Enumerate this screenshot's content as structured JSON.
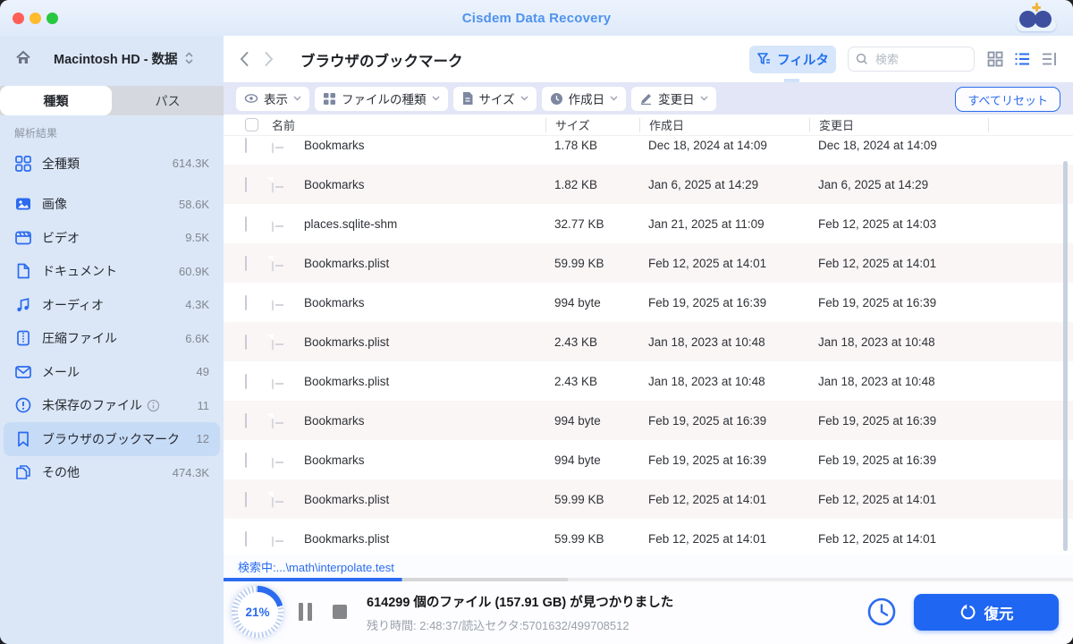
{
  "window": {
    "title": "Cisdem Data Recovery"
  },
  "sidebar": {
    "drive_label": "Macintosh HD - 数据",
    "tabs": [
      {
        "label": "種類"
      },
      {
        "label": "パス"
      }
    ],
    "section_label": "解析結果",
    "items": [
      {
        "label": "全種類",
        "count": "614.3K",
        "icon": "grid-icon"
      },
      {
        "label": "画像",
        "count": "58.6K",
        "icon": "image-icon"
      },
      {
        "label": "ビデオ",
        "count": "9.5K",
        "icon": "video-icon"
      },
      {
        "label": "ドキュメント",
        "count": "60.9K",
        "icon": "document-icon"
      },
      {
        "label": "オーディオ",
        "count": "4.3K",
        "icon": "audio-icon"
      },
      {
        "label": "圧縮ファイル",
        "count": "6.6K",
        "icon": "archive-icon"
      },
      {
        "label": "メール",
        "count": "49",
        "icon": "mail-icon"
      },
      {
        "label": "未保存のファイル",
        "count": "11",
        "icon": "unsaved-icon"
      },
      {
        "label": "ブラウザのブックマーク",
        "count": "12",
        "icon": "bookmark-icon"
      },
      {
        "label": "その他",
        "count": "474.3K",
        "icon": "others-icon"
      }
    ]
  },
  "toolbar": {
    "page_title": "ブラウザのブックマーク",
    "filter_label": "フィルタ",
    "search_placeholder": "検索"
  },
  "filter_bar": {
    "chips": [
      {
        "label": "表示",
        "icon": "eye-icon"
      },
      {
        "label": "ファイルの種類",
        "icon": "grid-icon"
      },
      {
        "label": "サイズ",
        "icon": "file-icon"
      },
      {
        "label": "作成日",
        "icon": "clock-icon"
      },
      {
        "label": "変更日",
        "icon": "pencil-icon"
      }
    ],
    "reset_label": "すべてリセット"
  },
  "table": {
    "columns": {
      "name": "名前",
      "size": "サイズ",
      "created": "作成日",
      "modified": "変更日"
    },
    "rows": [
      {
        "name": "Bookmarks",
        "size": "1.78 KB",
        "created": "Dec 18, 2024 at 14:09",
        "modified": "Dec 18, 2024 at 14:09"
      },
      {
        "name": "Bookmarks",
        "size": "1.82 KB",
        "created": "Jan 6, 2025 at 14:29",
        "modified": "Jan 6, 2025 at 14:29"
      },
      {
        "name": "places.sqlite-shm",
        "size": "32.77 KB",
        "created": "Jan 21, 2025 at 11:09",
        "modified": "Feb 12, 2025 at 14:03"
      },
      {
        "name": "Bookmarks.plist",
        "size": "59.99 KB",
        "created": "Feb 12, 2025 at 14:01",
        "modified": "Feb 12, 2025 at 14:01"
      },
      {
        "name": "Bookmarks",
        "size": "994 byte",
        "created": "Feb 19, 2025 at 16:39",
        "modified": "Feb 19, 2025 at 16:39"
      },
      {
        "name": "Bookmarks.plist",
        "size": "2.43 KB",
        "created": "Jan 18, 2023 at 10:48",
        "modified": "Jan 18, 2023 at 10:48"
      },
      {
        "name": "Bookmarks.plist",
        "size": "2.43 KB",
        "created": "Jan 18, 2023 at 10:48",
        "modified": "Jan 18, 2023 at 10:48"
      },
      {
        "name": "Bookmarks",
        "size": "994 byte",
        "created": "Feb 19, 2025 at 16:39",
        "modified": "Feb 19, 2025 at 16:39"
      },
      {
        "name": "Bookmarks",
        "size": "994 byte",
        "created": "Feb 19, 2025 at 16:39",
        "modified": "Feb 19, 2025 at 16:39"
      },
      {
        "name": "Bookmarks.plist",
        "size": "59.99 KB",
        "created": "Feb 12, 2025 at 14:01",
        "modified": "Feb 12, 2025 at 14:01"
      },
      {
        "name": "Bookmarks.plist",
        "size": "59.99 KB",
        "created": "Feb 12, 2025 at 14:01",
        "modified": "Feb 12, 2025 at 14:01"
      }
    ]
  },
  "status": {
    "scanning_text": "検索中:...\\math\\interpolate.test",
    "progress_percent": "21%",
    "found_text": "614299 個のファイル (157.91 GB) が見つかりました",
    "remaining_text": "残り時間: 2:48:37/読込セクタ:5701632/499708512",
    "recover_label": "復元"
  },
  "colors": {
    "accent": "#2b6bf0",
    "sidebar_bg": "#dbe7f7",
    "alt_row": "#faf6f6"
  }
}
